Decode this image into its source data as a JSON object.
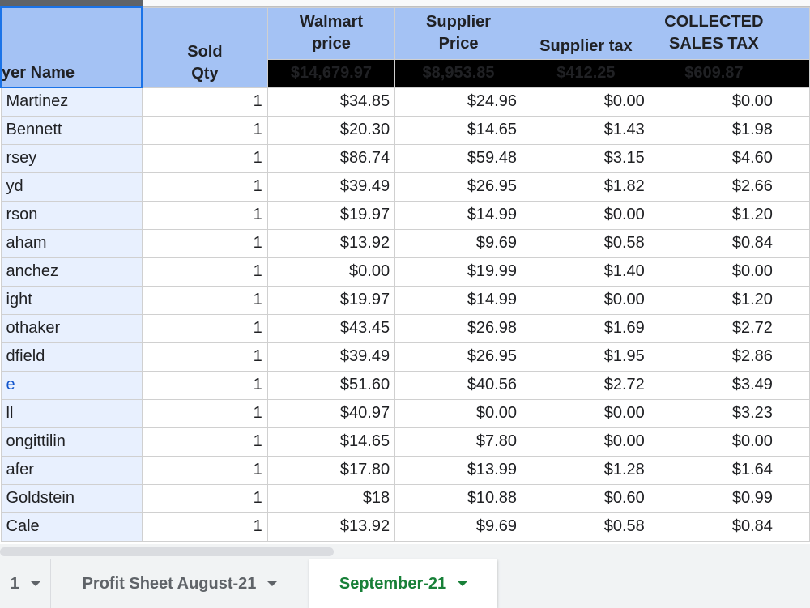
{
  "headers": {
    "buyer_name": "yer Name",
    "sold_qty": "Sold\nQty",
    "walmart_price": "Walmart\nprice",
    "supplier_price": "Supplier\nPrice",
    "supplier_tax": "Supplier tax",
    "collected_sales_tax": "COLLECTED\nSALES TAX"
  },
  "totals": {
    "walmart_price": "$14,679.97",
    "supplier_price": "$8,953.85",
    "supplier_tax": "$412.25",
    "collected_sales_tax": "$609.87"
  },
  "rows": [
    {
      "name": "Martinez",
      "qty": "1",
      "walmart": "$34.85",
      "supplier": "$24.96",
      "stax": "$0.00",
      "ctax": "$0.00"
    },
    {
      "name": "Bennett",
      "qty": "1",
      "walmart": "$20.30",
      "supplier": "$14.65",
      "stax": "$1.43",
      "ctax": "$1.98"
    },
    {
      "name": "rsey",
      "qty": "1",
      "walmart": "$86.74",
      "supplier": "$59.48",
      "stax": "$3.15",
      "ctax": "$4.60"
    },
    {
      "name": "yd",
      "qty": "1",
      "walmart": "$39.49",
      "supplier": "$26.95",
      "stax": "$1.82",
      "ctax": "$2.66"
    },
    {
      "name": "rson",
      "qty": "1",
      "walmart": "$19.97",
      "supplier": "$14.99",
      "stax": "$0.00",
      "ctax": "$1.20"
    },
    {
      "name": "aham",
      "qty": "1",
      "walmart": "$13.92",
      "supplier": "$9.69",
      "stax": "$0.58",
      "ctax": "$0.84"
    },
    {
      "name": "anchez",
      "qty": "1",
      "walmart": "$0.00",
      "supplier": "$19.99",
      "stax": "$1.40",
      "ctax": "$0.00"
    },
    {
      "name": "ight",
      "qty": "1",
      "walmart": "$19.97",
      "supplier": "$14.99",
      "stax": "$0.00",
      "ctax": "$1.20"
    },
    {
      "name": "othaker",
      "qty": "1",
      "walmart": "$43.45",
      "supplier": "$26.98",
      "stax": "$1.69",
      "ctax": "$2.72"
    },
    {
      "name": "dfield",
      "qty": "1",
      "walmart": "$39.49",
      "supplier": "$26.95",
      "stax": "$1.95",
      "ctax": "$2.86"
    },
    {
      "name": "e",
      "qty": "1",
      "walmart": "$51.60",
      "supplier": "$40.56",
      "stax": "$2.72",
      "ctax": "$3.49",
      "link": true
    },
    {
      "name": "ll",
      "qty": "1",
      "walmart": "$40.97",
      "supplier": "$0.00",
      "stax": "$0.00",
      "ctax": "$3.23"
    },
    {
      "name": "ongittilin",
      "qty": "1",
      "walmart": "$14.65",
      "supplier": "$7.80",
      "stax": "$0.00",
      "ctax": "$0.00"
    },
    {
      "name": "afer",
      "qty": "1",
      "walmart": "$17.80",
      "supplier": "$13.99",
      "stax": "$1.28",
      "ctax": "$1.64"
    },
    {
      "name": " Goldstein",
      "qty": "1",
      "walmart": "$18",
      "supplier": "$10.88",
      "stax": "$0.60",
      "ctax": "$0.99"
    },
    {
      "name": " Cale",
      "qty": "1",
      "walmart": "$13.92",
      "supplier": "$9.69",
      "stax": "$0.58",
      "ctax": "$0.84"
    }
  ],
  "tabs": [
    {
      "label": "1"
    },
    {
      "label": "Profit Sheet August-21"
    },
    {
      "label": "September-21",
      "active": true
    }
  ],
  "colors": {
    "header_bg": "#a4c2f4",
    "total_bg": "#000000",
    "total_text": "#00ff00",
    "name_bg": "#e8f0fe",
    "active_tab_text": "#188038"
  }
}
